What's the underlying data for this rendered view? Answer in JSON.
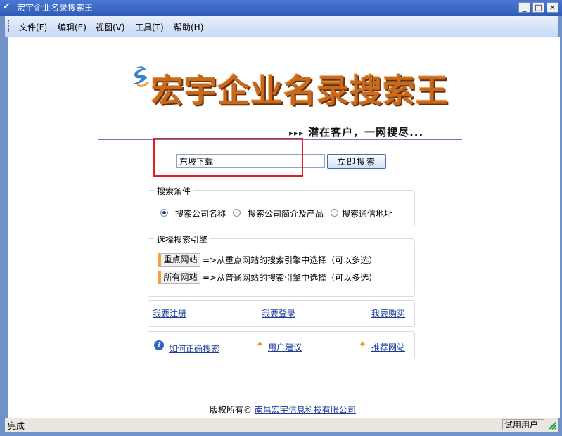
{
  "window": {
    "title": "宏宇企业名录搜索王",
    "minimize_glyph": "_",
    "maximize_glyph": "□",
    "close_glyph": "×"
  },
  "menu": {
    "items": [
      {
        "label": "文件(F)"
      },
      {
        "label": "编辑(E)"
      },
      {
        "label": "视图(V)"
      },
      {
        "label": "工具(T)"
      },
      {
        "label": "帮助(H)"
      }
    ]
  },
  "logo": {
    "text": "宏宇企业名录搜索王",
    "mark_icon": "swirl-logo-icon"
  },
  "slogan": {
    "arrows": "▸▸▸",
    "text": "潜在客户，一网搜尽..."
  },
  "search": {
    "value": "东坡下载",
    "button_label": "立即搜索"
  },
  "conditions": {
    "legend": "搜索条件",
    "options": [
      {
        "label": "搜索公司名称",
        "selected": true
      },
      {
        "label": "搜索公司简介及产品",
        "selected": false
      },
      {
        "label": "搜索通信地址",
        "selected": false
      }
    ]
  },
  "engines": {
    "legend": "选择搜索引擎",
    "rows": [
      {
        "button": "重点网站",
        "desc": "=>从重点网站的搜索引擎中选择（可以多选）"
      },
      {
        "button": "所有网站",
        "desc": "=>从普通网站的搜索引擎中选择（可以多选）"
      }
    ]
  },
  "account_links": {
    "register": "我要注册",
    "login": "我要登录",
    "buy": "我要购买"
  },
  "help_links": {
    "how_to": "如何正确搜索",
    "suggest": "用户建议",
    "recommend": "推荐网站"
  },
  "footer": {
    "prefix": "版权所有©",
    "company": "南昌宏宇信息科技有限公司"
  },
  "status": {
    "left": "完成",
    "right": "试用用户"
  },
  "colors": {
    "highlight": "#e01f1f",
    "logo_orange": "#c86a1d",
    "link_blue": "#1b3c9a"
  }
}
